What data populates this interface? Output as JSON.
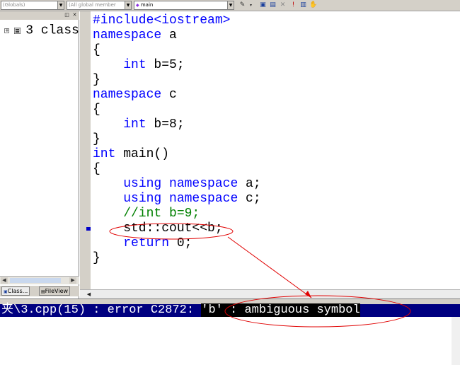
{
  "toolbar": {
    "combo_globals": "(Globals)",
    "combo_members": "(All global member",
    "combo_function": "main",
    "icons": [
      "wizard-icon",
      "class-icon",
      "build-icon",
      "stop-icon",
      "execute-icon",
      "breakpoint-icon",
      "hand-icon"
    ]
  },
  "workspace": {
    "tree_item": "3 class",
    "tabs": [
      "Class...",
      "FileView"
    ]
  },
  "editor": {
    "lines": [
      {
        "text": "#include<iostream>",
        "kind": "kw"
      },
      {
        "text": "namespace a",
        "kind": "mixed"
      },
      {
        "text": "{"
      },
      {
        "text": "    int b=5;"
      },
      {
        "text": "}"
      },
      {
        "text": "namespace c"
      },
      {
        "text": "{"
      },
      {
        "text": "    int b=8;"
      },
      {
        "text": "}"
      },
      {
        "text": "int main()"
      },
      {
        "text": "{"
      },
      {
        "text": "    using namespace a;"
      },
      {
        "text": "    using namespace c;"
      },
      {
        "text": "    //int b=9;"
      },
      {
        "text": "    std::cout<<b;"
      },
      {
        "text": "    return 0;"
      },
      {
        "text": "}"
      }
    ]
  },
  "output": {
    "error_location": "夹\\3.cpp(15) : error C2872: ",
    "error_message": "'b' : ambiguous symbol"
  },
  "colors": {
    "keyword": "#0000ff",
    "comment": "#008000",
    "error_bar": "#000080",
    "annotation": "#e00000"
  }
}
